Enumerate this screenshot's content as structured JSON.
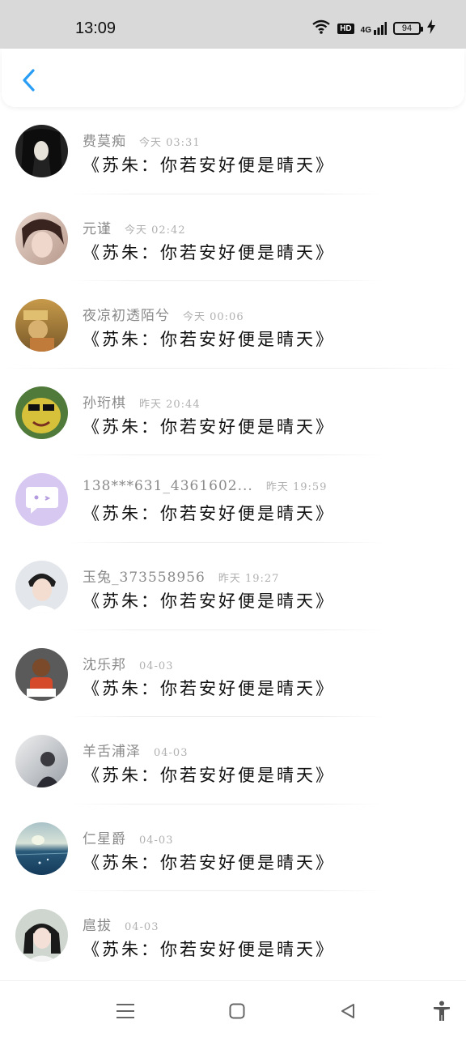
{
  "status_bar": {
    "time": "13:09",
    "hd_label": "HD",
    "network_label": "4G",
    "battery_level": "94",
    "icons": [
      "wifi-icon",
      "hd-icon",
      "signal-icon",
      "battery-icon",
      "charging-icon"
    ]
  },
  "header": {
    "back_icon": "chevron-left-icon",
    "accent_color": "#2a9df4"
  },
  "messages": [
    {
      "name": "费莫痴",
      "time": "今天 03:31",
      "text": "《苏朱：你若安好便是晴天》"
    },
    {
      "name": "元谨",
      "time": "今天 02:42",
      "text": "《苏朱：你若安好便是晴天》"
    },
    {
      "name": "夜凉初透陌兮",
      "time": "今天 00:06",
      "text": "《苏朱：你若安好便是晴天》"
    },
    {
      "name": "孙珩棋",
      "time": "昨天 20:44",
      "text": "《苏朱：你若安好便是晴天》"
    },
    {
      "name": "138***631_4361602...",
      "time": "昨天 19:59",
      "text": "《苏朱：你若安好便是晴天》"
    },
    {
      "name": "玉兔_373558956",
      "time": "昨天 19:27",
      "text": "《苏朱：你若安好便是晴天》"
    },
    {
      "name": "沈乐邦",
      "time": "04-03",
      "text": "《苏朱：你若安好便是晴天》"
    },
    {
      "name": "羊舌浦泽",
      "time": "04-03",
      "text": "《苏朱：你若安好便是晴天》"
    },
    {
      "name": "仁星爵",
      "time": "04-03",
      "text": "《苏朱：你若安好便是晴天》"
    },
    {
      "name": "扈拔",
      "time": "04-03",
      "text": "《苏朱：你若安好便是晴天》"
    }
  ],
  "nav_bar": {
    "icons": [
      "menu-icon",
      "home-icon",
      "back-triangle-icon",
      "accessibility-icon"
    ]
  }
}
